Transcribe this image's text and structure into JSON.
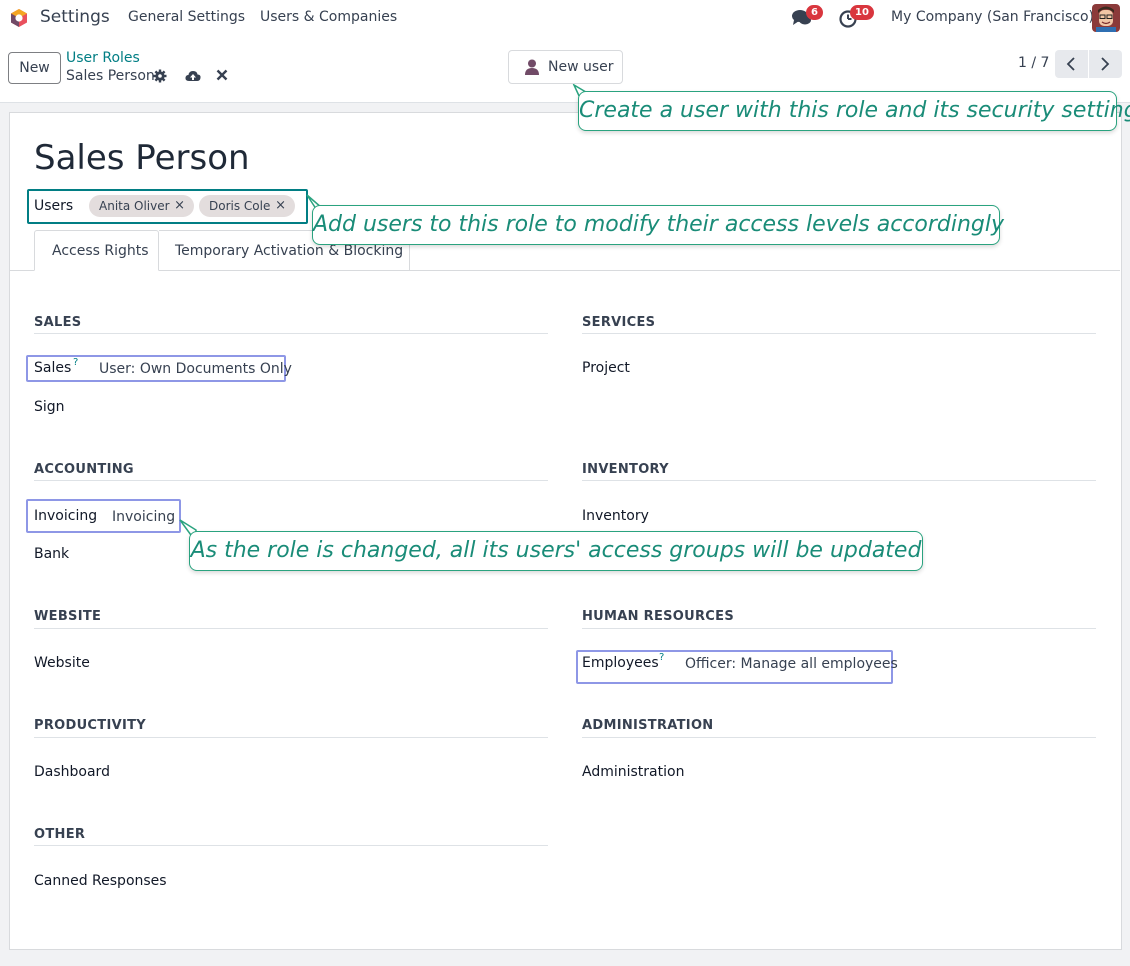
{
  "navbar": {
    "app_name": "Settings",
    "menu": [
      "General Settings",
      "Users & Companies"
    ],
    "chat_count": "6",
    "activity_count": "10",
    "company": "My Company (San Francisco)"
  },
  "control": {
    "new_label": "New",
    "breadcrumb_parent": "User Roles",
    "breadcrumb_current": "Sales Person",
    "new_user_label": "New user",
    "pager": "1 / 7"
  },
  "form": {
    "title": "Sales Person",
    "users_label": "Users",
    "users": [
      "Anita Oliver",
      "Doris Cole"
    ],
    "tabs": [
      "Access Rights",
      "Temporary Activation & Blocking"
    ]
  },
  "sections": {
    "sales": {
      "title": "SALES",
      "fields": [
        {
          "label": "Sales",
          "value": "User: Own Documents Only"
        },
        {
          "label": "Sign",
          "value": ""
        }
      ]
    },
    "services": {
      "title": "SERVICES",
      "fields": [
        {
          "label": "Project",
          "value": ""
        }
      ]
    },
    "accounting": {
      "title": "ACCOUNTING",
      "fields": [
        {
          "label": "Invoicing",
          "value": "Invoicing"
        },
        {
          "label": "Bank",
          "value": ""
        }
      ]
    },
    "inventory": {
      "title": "INVENTORY",
      "fields": [
        {
          "label": "Inventory",
          "value": ""
        }
      ]
    },
    "website": {
      "title": "WEBSITE",
      "fields": [
        {
          "label": "Website",
          "value": ""
        }
      ]
    },
    "hr": {
      "title": "HUMAN RESOURCES",
      "fields": [
        {
          "label": "Employees",
          "value": "Officer: Manage all employees"
        }
      ]
    },
    "productivity": {
      "title": "PRODUCTIVITY",
      "fields": [
        {
          "label": "Dashboard",
          "value": ""
        }
      ]
    },
    "administration": {
      "title": "ADMINISTRATION",
      "fields": [
        {
          "label": "Administration",
          "value": ""
        }
      ]
    },
    "other": {
      "title": "OTHER",
      "fields": [
        {
          "label": "Canned Responses",
          "value": ""
        }
      ]
    }
  },
  "help_mark": "?",
  "tag_remove": "×",
  "tooltips": {
    "new_user": "Create a user with this role and its security settings",
    "users": "Add users to this role to modify their access levels accordingly",
    "role_change": "As the role is changed, all its users' access groups will be updated"
  },
  "colors": {
    "accent": "#017e84",
    "tooltip": "#1a8c78",
    "highlight": "#8e97e6",
    "badge": "#d9363e"
  }
}
